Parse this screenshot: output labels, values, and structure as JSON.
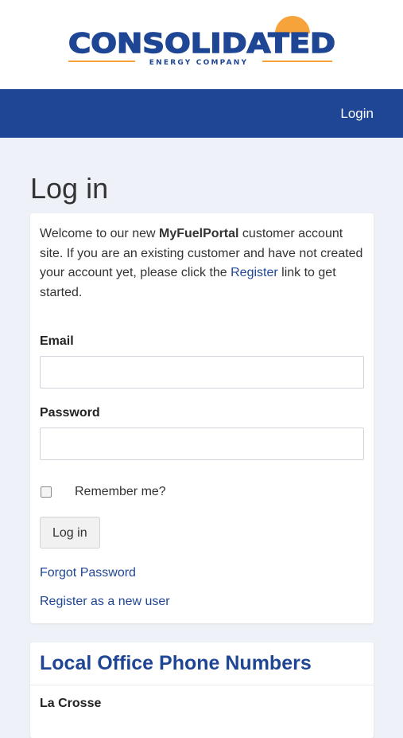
{
  "header": {
    "logo": {
      "name": "CONSOLIDATED",
      "subtitle": "ENERGY COMPANY",
      "colors": {
        "navy": "#1f4694",
        "orange": "#f5a33a"
      }
    }
  },
  "nav": {
    "login_label": "Login"
  },
  "page": {
    "title": "Log in"
  },
  "login_card": {
    "intro_prefix": "Welcome to our new ",
    "intro_brand": "MyFuelPortal",
    "intro_middle": " customer account site. If you are an existing customer and have not created your account yet, please click the ",
    "intro_link": "Register",
    "intro_suffix": " link to get started.",
    "email_label": "Email",
    "email_value": "",
    "password_label": "Password",
    "password_value": "",
    "remember_label": "Remember me?",
    "remember_checked": false,
    "submit_label": "Log in",
    "forgot_label": "Forgot Password",
    "register_label": "Register as a new user"
  },
  "offices_card": {
    "title": "Local Office Phone Numbers",
    "first_office": "La Crosse"
  },
  "colors": {
    "brand_blue": "#1f4694",
    "background": "#eef1f7"
  }
}
